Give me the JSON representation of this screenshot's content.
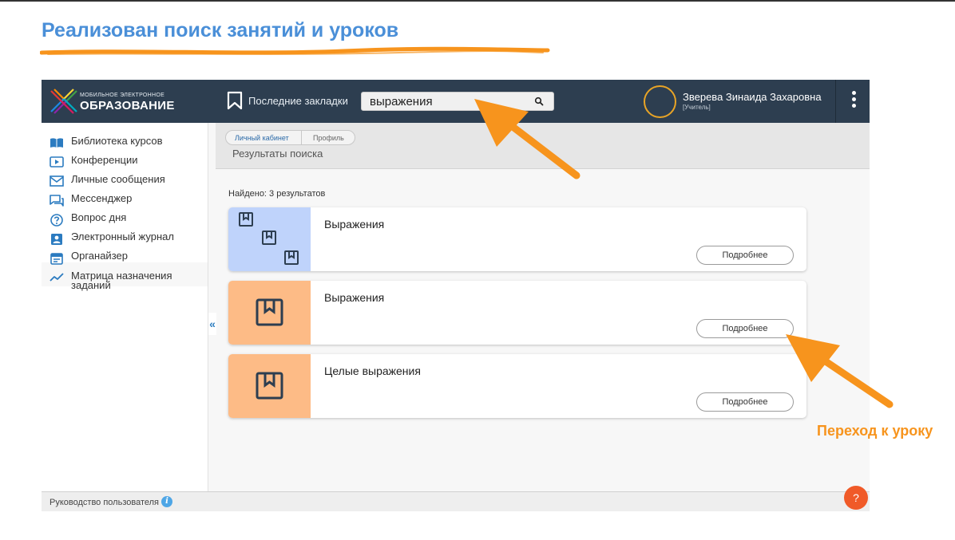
{
  "slide": {
    "title": "Реализован поиск занятий и уроков",
    "annotation": "Переход к уроку",
    "accent_color": "#f7941d",
    "title_color": "#4a8fd8"
  },
  "header": {
    "logo_small": "МОБИЛЬНОЕ ЭЛЕКТРОННОЕ",
    "logo_big": "ОБРАЗОВАНИЕ",
    "bookmarks_label": "Последние закладки",
    "search_value": "выражения",
    "user_name": "Зверева Зинаида Захаровна",
    "user_role": "[Учитель]",
    "bg_color": "#2d3e50"
  },
  "sidebar": {
    "items": [
      {
        "label": "Библиотека курсов",
        "icon": "book-icon"
      },
      {
        "label": "Конференции",
        "icon": "video-play-icon"
      },
      {
        "label": "Личные сообщения",
        "icon": "envelope-icon"
      },
      {
        "label": "Мессенджер",
        "icon": "chat-icon"
      },
      {
        "label": "Вопрос дня",
        "icon": "question-icon"
      },
      {
        "label": "Электронный журнал",
        "icon": "journal-icon"
      },
      {
        "label": "Органайзер",
        "icon": "calendar-icon"
      },
      {
        "label": "Матрица назначения заданий",
        "icon": "trend-line-icon"
      }
    ],
    "collapse_label": "«"
  },
  "breadcrumb": [
    "Личный кабинет",
    "Профиль"
  ],
  "page_title": "Результаты поиска",
  "results": {
    "found_text": "Найдено: 3 результатов",
    "items": [
      {
        "title": "Выражения",
        "button": "Подробнее",
        "thumb_color": "#bfd3fb"
      },
      {
        "title": "Выражения",
        "button": "Подробнее",
        "thumb_color": "#fdbb86"
      },
      {
        "title": "Целые выражения",
        "button": "Подробнее",
        "thumb_color": "#fdbb86"
      }
    ]
  },
  "footer": {
    "guide_label": "Руководство пользователя",
    "info_label": "i",
    "help_label": "?"
  }
}
